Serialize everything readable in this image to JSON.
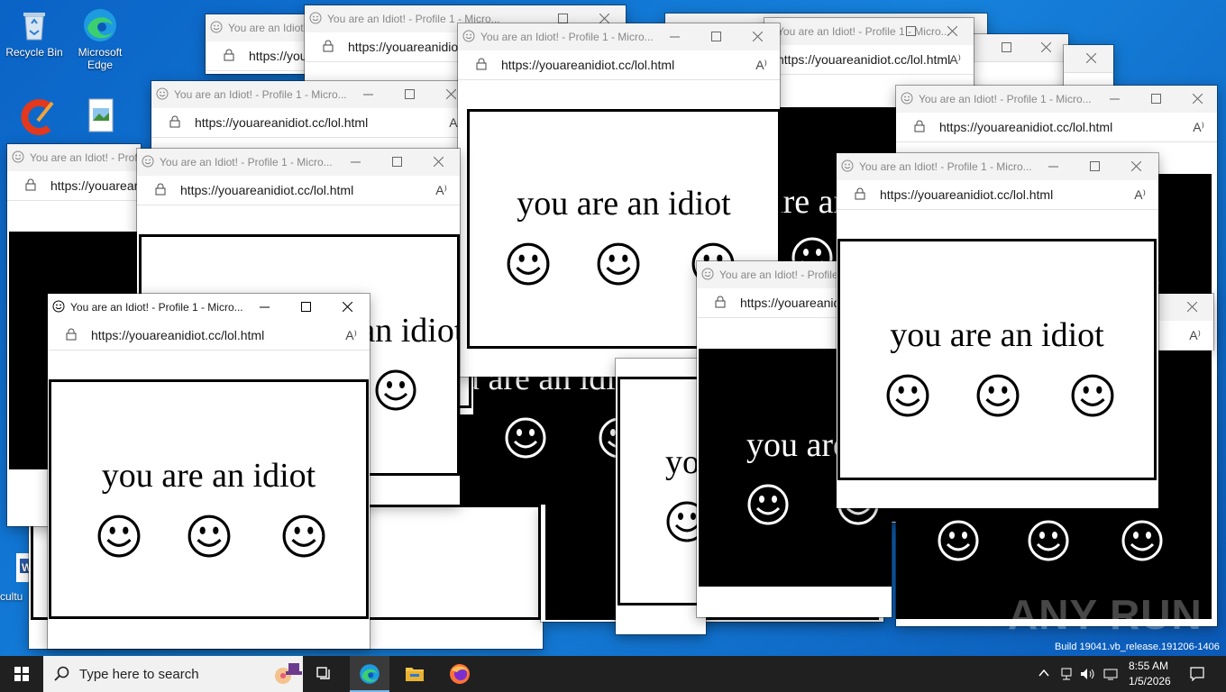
{
  "desktop": {
    "icons": [
      {
        "label": "Recycle Bin"
      },
      {
        "label": "Microsoft Edge"
      },
      {
        "label": ""
      },
      {
        "label": ""
      },
      {
        "label": "cultu"
      }
    ],
    "build_text": "Build 19041.vb_release.191206-1406",
    "watermark": "ANY RUN"
  },
  "window": {
    "title": "You are an Idiot! - Profile 1 - Micro...",
    "url": "https://youareanidiot.cc/lol.html",
    "read_aloud_icon": "A⁾",
    "page_text": "you are an idiot"
  },
  "taskbar": {
    "search_placeholder": "Type here to search",
    "time": "8:55 AM",
    "date": "1/5/2026",
    "apps": [
      "start-icon",
      "search-icon",
      "task-view-icon",
      "edge-icon",
      "file-explorer-icon",
      "firefox-icon"
    ]
  }
}
